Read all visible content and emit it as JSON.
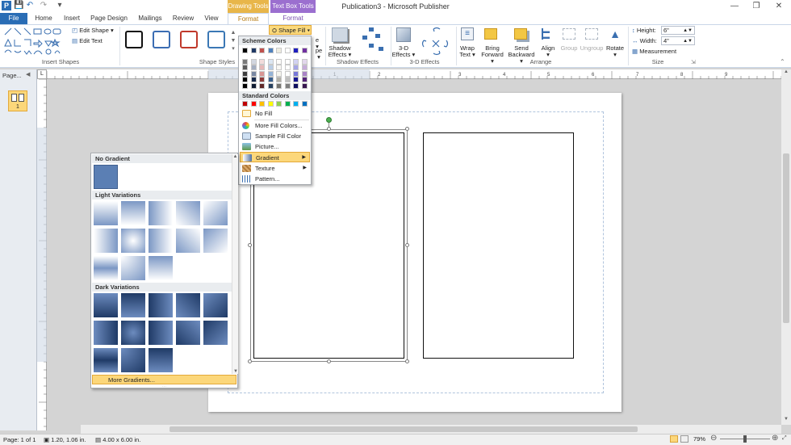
{
  "window": {
    "title": "Publication3 - Microsoft Publisher",
    "contextual_headers": [
      "Drawing Tools",
      "Text Box Tools"
    ],
    "file_tab": "File",
    "tabs": [
      "Home",
      "Insert",
      "Page Design",
      "Mailings",
      "Review",
      "View",
      "Format",
      "Format"
    ],
    "active_tab_index": 6
  },
  "ribbon": {
    "edit_shape": "Edit Shape",
    "edit_text": "Edit Text",
    "shape_fill": "Shape Fill",
    "shadow_effects": [
      "Shadow",
      "Effects"
    ],
    "three_d_effects": [
      "3-D",
      "Effects"
    ],
    "wrap_text": [
      "Wrap",
      "Text"
    ],
    "bring_forward": [
      "Bring",
      "Forward"
    ],
    "send_backward": [
      "Send",
      "Backward"
    ],
    "align": "Align",
    "group": "Group",
    "ungroup": "Ungroup",
    "rotate": "Rotate",
    "height_label": "Height:",
    "height_value": "6\"",
    "width_label": "Width:",
    "width_value": "4\"",
    "measurement": "Measurement",
    "groups": [
      "Insert Shapes",
      "Shape Styles",
      "Shadow Effects",
      "3-D Effects",
      "Arrange",
      "Size"
    ],
    "style_colors": [
      "#111111",
      "#3b6db3",
      "#c0392b",
      "#3b78b5"
    ]
  },
  "page_nav": {
    "label": "Page...",
    "page_number": "1"
  },
  "fill_menu": {
    "scheme_header": "Scheme Colors",
    "scheme_colors": [
      "#000000",
      "#1f3864",
      "#c0504d",
      "#4f81bd",
      "#eeece1",
      "#ffffff",
      "#1f1fbf",
      "#7030a0"
    ],
    "standard_header": "Standard Colors",
    "standard_colors": [
      "#c00000",
      "#ff0000",
      "#ffc000",
      "#ffff00",
      "#92d050",
      "#00b050",
      "#00b0f0",
      "#0070c0"
    ],
    "items": [
      "No Fill",
      "More Fill Colors...",
      "Sample Fill Color",
      "Picture...",
      "Gradient",
      "Texture",
      "Pattern..."
    ]
  },
  "gradient_gallery": {
    "no_gradient": "No Gradient",
    "light_variations": "Light Variations",
    "dark_variations": "Dark Variations",
    "more_gradients": "More Gradients..."
  },
  "status_bar": {
    "page": "Page: 1 of 1",
    "position": "1.20, 1.06 in.",
    "size": "4.00 x 6.00 in.",
    "zoom": "79%"
  }
}
